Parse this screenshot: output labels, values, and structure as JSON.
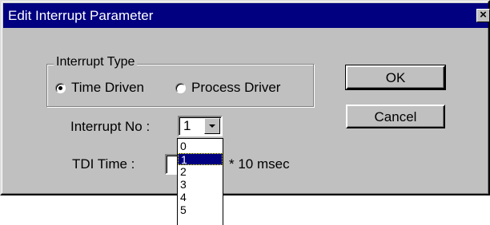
{
  "window": {
    "title": "Edit Interrupt Parameter",
    "close_glyph": "×"
  },
  "interrupt_type": {
    "legend": "Interrupt Type",
    "options": [
      {
        "label": "Time Driven",
        "checked": true
      },
      {
        "label": "Process Driver",
        "checked": false
      }
    ]
  },
  "interrupt_no": {
    "label": "Interrupt No :",
    "value": "1",
    "options": [
      "0",
      "1",
      "2",
      "3",
      "4",
      "5"
    ],
    "highlighted_index": 1
  },
  "tdi_time": {
    "label": "TDI Time :",
    "value": "",
    "unit": "* 10 msec"
  },
  "buttons": {
    "ok": "OK",
    "cancel": "Cancel"
  },
  "colors": {
    "titlebar": "#000080",
    "face": "#c0c0c0",
    "selection": "#000080"
  }
}
